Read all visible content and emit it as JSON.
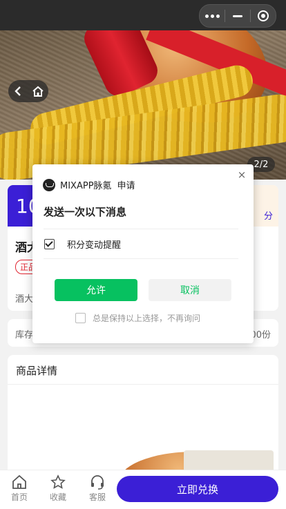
{
  "hero": {
    "pager": "2/2"
  },
  "product": {
    "price_fragment": "10",
    "name_fragment": "酒大",
    "badge_fragment": "正品",
    "subtitle_fragment": "酒大",
    "stock_label": "库存",
    "stock_fragment": "00份",
    "right_fragment": "分"
  },
  "details": {
    "title": "商品详情"
  },
  "tabbar": {
    "home": "首页",
    "fav": "收藏",
    "service": "客服",
    "buy": "立即兑换"
  },
  "dialog": {
    "app": "MIXAPP脉氪",
    "request": "申请",
    "title": "发送一次以下消息",
    "permission": "积分变动提醒",
    "allow": "允许",
    "cancel": "取消",
    "keep": "总是保持以上选择，不再询问",
    "close": "×"
  },
  "colors": {
    "accent": "#3b1fd6",
    "wechat_green": "#07c160"
  }
}
